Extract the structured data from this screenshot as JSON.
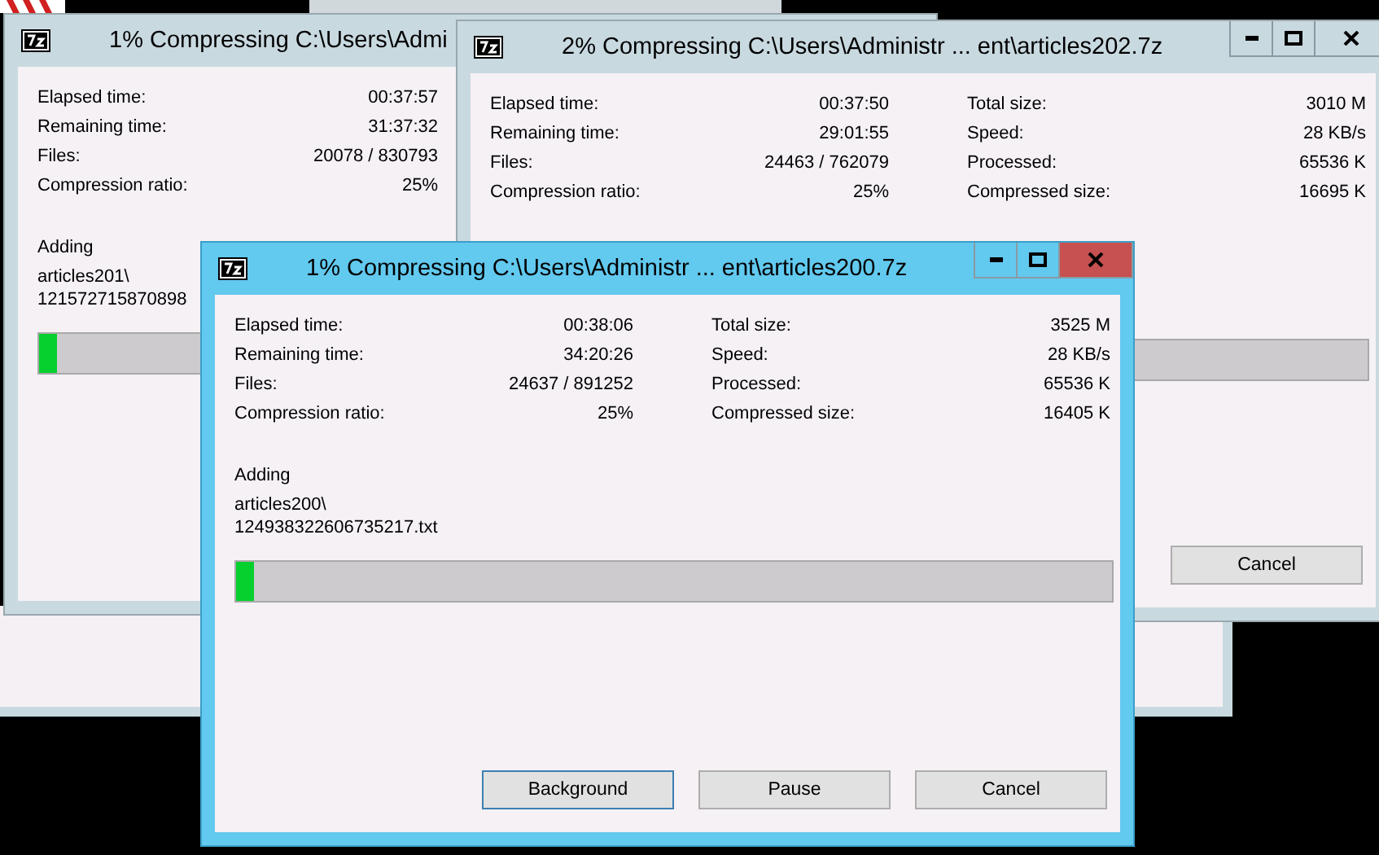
{
  "windows": [
    {
      "title": "1% Compressing C:\\Users\\Admi",
      "active": false,
      "stats": [
        {
          "label": "Elapsed time:",
          "value": "00:37:57"
        },
        {
          "label": "Remaining time:",
          "value": "31:37:32"
        },
        {
          "label": "Files:",
          "value": "20078 / 830793"
        },
        {
          "label": "Compression ratio:",
          "value": "25%"
        }
      ],
      "adding": {
        "label": "Adding",
        "path": [
          "articles201\\",
          "121572715870898"
        ]
      },
      "level": 0.02
    },
    {
      "title": "2% Compressing C:\\Users\\Administr ... ent\\articles202.7z",
      "active": false,
      "window_controls": [
        {
          "kind": "minimize"
        },
        {
          "kind": "maximize"
        },
        {
          "kind": "close"
        }
      ],
      "stats": [
        {
          "label": "Elapsed time:",
          "value": "00:37:50"
        },
        {
          "label": "Remaining time:",
          "value": "29:01:55"
        },
        {
          "label": "Files:",
          "value": "24463 / 762079"
        },
        {
          "label": "Compression ratio:",
          "value": "25%"
        }
      ],
      "stats_right": [
        {
          "label": "Total size:",
          "value": "3010 M"
        },
        {
          "label": "Speed:",
          "value": "28 KB/s"
        },
        {
          "label": "Processed:",
          "value": "65536 K"
        },
        {
          "label": "Compressed size:",
          "value": "16695 K"
        }
      ],
      "buttons": [
        {
          "label": "Cancel",
          "default": false
        }
      ]
    },
    {
      "title": "1% Compressing C:\\Users\\Administr ... ent\\articles200.7z",
      "active": true,
      "window_controls": [
        {
          "kind": "minimize"
        },
        {
          "kind": "maximize"
        },
        {
          "kind": "close"
        }
      ],
      "stats": [
        {
          "label": "Elapsed time:",
          "value": "00:38:06"
        },
        {
          "label": "Remaining time:",
          "value": "34:20:26"
        },
        {
          "label": "Files:",
          "value": "24637 / 891252"
        },
        {
          "label": "Compression ratio:",
          "value": "25%"
        }
      ],
      "stats_right": [
        {
          "label": "Total size:",
          "value": "3525 M"
        },
        {
          "label": "Speed:",
          "value": "28 KB/s"
        },
        {
          "label": "Processed:",
          "value": "65536 K"
        },
        {
          "label": "Compressed size:",
          "value": "16405 K"
        }
      ],
      "adding": {
        "label": "Adding",
        "path": [
          "articles200\\",
          "124938322606735217.txt"
        ]
      },
      "level": 0.02,
      "buttons": [
        {
          "label": "Background",
          "default": true
        },
        {
          "label": "Pause",
          "default": false
        },
        {
          "label": "Cancel",
          "default": false
        }
      ]
    }
  ]
}
